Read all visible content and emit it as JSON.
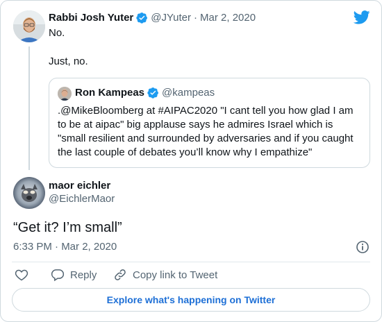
{
  "tweet1": {
    "author_name": "Rabbi Josh Yuter",
    "handle": "@JYuter",
    "separator": "·",
    "date": "Mar 2, 2020",
    "line1": "No.",
    "line2": "Just, no."
  },
  "quote": {
    "author_name": "Ron Kampeas",
    "handle": "@kampeas",
    "text": ".@MikeBloomberg at #AIPAC2020 \"I cant tell you how glad I am to be at aipac\" big applause says he admires Israel which is \"small resilient and surrounded by adversaries and if you caught the last couple of debates you’ll know why I empathize\""
  },
  "tweet2": {
    "author_name": "maor eichler",
    "handle": "@EichlerMaor",
    "text": "“Get it? I’m small”",
    "timestamp": "6:33 PM · Mar 2, 2020"
  },
  "actions": {
    "reply_label": "Reply",
    "copy_label": "Copy link to Tweet"
  },
  "footer": {
    "explore_label": "Explore what's happening on Twitter"
  },
  "icons": {
    "brand": "twitter-bird-icon",
    "verified": "verified-badge-icon",
    "info": "info-icon",
    "like": "heart-icon",
    "reply": "reply-icon",
    "copy": "link-icon"
  },
  "colors": {
    "brand_blue": "#1d9bf0",
    "link_blue": "#1d6fd6",
    "muted": "#536471",
    "border": "#cfd9de"
  }
}
